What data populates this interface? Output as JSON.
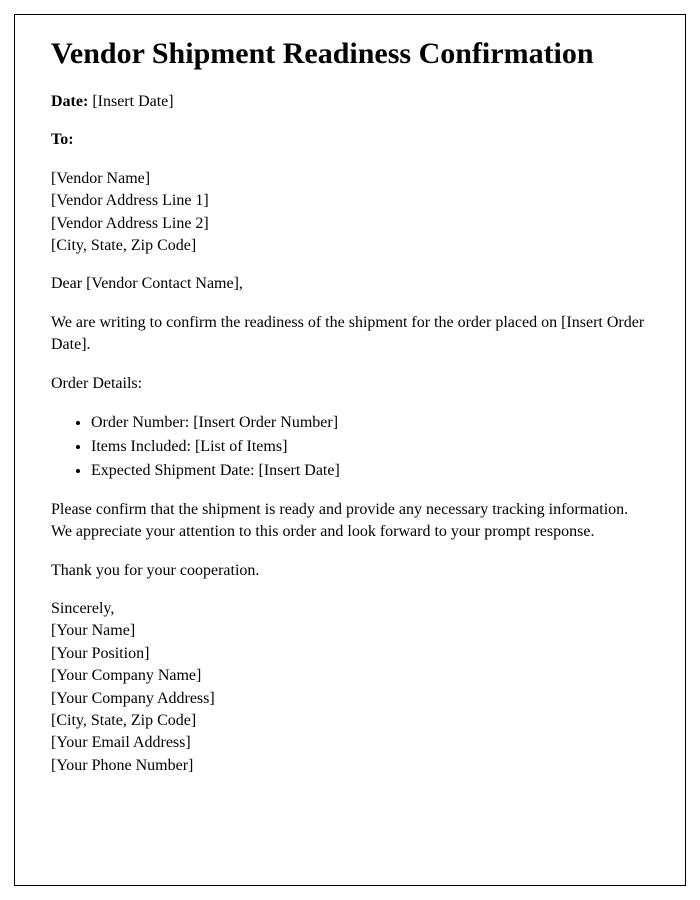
{
  "title": "Vendor Shipment Readiness Confirmation",
  "date": {
    "label": "Date:",
    "value": "[Insert Date]"
  },
  "to": {
    "label": "To:",
    "lines": [
      "[Vendor Name]",
      "[Vendor Address Line 1]",
      "[Vendor Address Line 2]",
      "[City, State, Zip Code]"
    ]
  },
  "salutation": "Dear [Vendor Contact Name],",
  "intro": "We are writing to confirm the readiness of the shipment for the order placed on [Insert Order Date].",
  "order_details": {
    "label": "Order Details:",
    "items": [
      "Order Number: [Insert Order Number]",
      "Items Included: [List of Items]",
      "Expected Shipment Date: [Insert Date]"
    ]
  },
  "request": "Please confirm that the shipment is ready and provide any necessary tracking information. We appreciate your attention to this order and look forward to your prompt response.",
  "thanks": "Thank you for your cooperation.",
  "closing": {
    "signoff": "Sincerely,",
    "lines": [
      "[Your Name]",
      "[Your Position]",
      "[Your Company Name]",
      "[Your Company Address]",
      "[City, State, Zip Code]",
      "[Your Email Address]",
      "[Your Phone Number]"
    ]
  }
}
